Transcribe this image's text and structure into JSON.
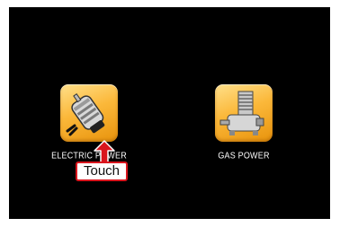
{
  "menu": {
    "items": [
      {
        "label": "ELECTRIC POWER",
        "icon": "electric-motor-icon"
      },
      {
        "label": "GAS POWER",
        "icon": "gas-engine-icon"
      }
    ]
  },
  "annotation": {
    "callout": "Touch",
    "arrow_icon": "up-arrow-icon",
    "color": "#d9151d"
  },
  "colors": {
    "screen_background": "#000000",
    "icon_gradient_light": "#ffe08a",
    "icon_gradient_dark": "#e8930c",
    "label_text": "#ffffff"
  }
}
